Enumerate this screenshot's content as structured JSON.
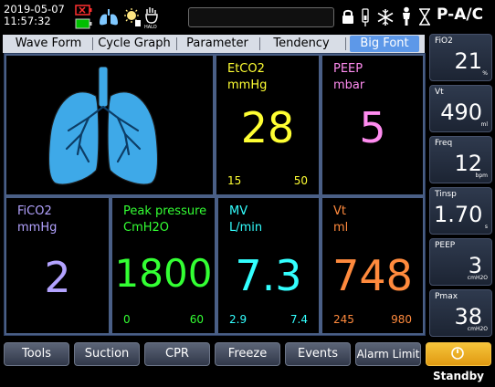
{
  "status_bar": {
    "date": "2019-05-07",
    "time": "11:57:32",
    "mode": "P-A/C",
    "icons": [
      "battery-warning-icon",
      "battery-icon",
      "lungs-icon",
      "sun-icon",
      "halo-icon",
      "lock-icon",
      "pen-icon",
      "snowflake-icon",
      "person-icon",
      "hourglass-icon"
    ]
  },
  "tabs": [
    {
      "label": "Wave Form"
    },
    {
      "label": "Cycle Graph"
    },
    {
      "label": "Parameter"
    },
    {
      "label": "Tendency"
    },
    {
      "label": "Big Font"
    }
  ],
  "cells": {
    "etco2": {
      "name": "EtCO2",
      "unit": "mmHg",
      "value": "28",
      "low": "15",
      "high": "50",
      "color": "#ffff33"
    },
    "peep": {
      "name": "PEEP",
      "unit": "mbar",
      "value": "5",
      "color": "#ff8cf0"
    },
    "fico2": {
      "name": "FiCO2",
      "unit": "mmHg",
      "value": "2",
      "color": "#b3a3ff"
    },
    "peak": {
      "name": "Peak pressure",
      "unit": "CmH2O",
      "value": "1800",
      "low": "0",
      "high": "60",
      "color": "#33ff33"
    },
    "mv": {
      "name": "MV",
      "unit": "L/min",
      "value": "7.3",
      "low": "2.9",
      "high": "7.4",
      "color": "#33ffff"
    },
    "vt": {
      "name": "Vt",
      "unit": "ml",
      "value": "748",
      "low": "245",
      "high": "980",
      "color": "#ff8a3d"
    }
  },
  "side_params": [
    {
      "label": "FiO2",
      "value": "21",
      "unit": "%"
    },
    {
      "label": "Vt",
      "value": "490",
      "unit": "ml"
    },
    {
      "label": "Freq",
      "value": "12",
      "unit": "bpm"
    },
    {
      "label": "Tinsp",
      "value": "1.70",
      "unit": "s"
    },
    {
      "label": "PEEP",
      "value": "3",
      "unit": "cmH2O"
    },
    {
      "label": "Pmax",
      "value": "38",
      "unit": "cmH2O"
    }
  ],
  "buttons": {
    "tools": "Tools",
    "suction": "Suction",
    "cpr": "CPR",
    "freeze": "Freeze",
    "events": "Events",
    "alarm_limit": "Alarm Limit",
    "standby": "Standby"
  },
  "colors": {
    "lung": "#3ea9e8",
    "tab_active": "#5d98e8",
    "standby": "#f0b020"
  }
}
